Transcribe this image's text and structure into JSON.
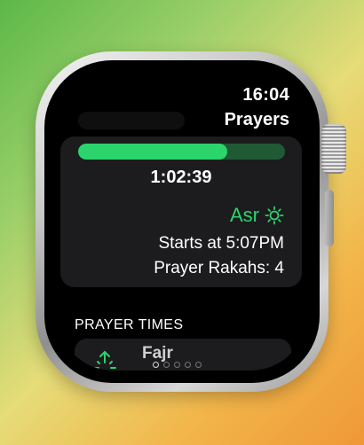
{
  "status": {
    "time": "16:04"
  },
  "app": {
    "title": "Prayers"
  },
  "current": {
    "progress": 0.72,
    "countdown": "1:02:39",
    "prayer_name": "Asr",
    "prayer_icon": "sun-icon",
    "starts_at": "Starts at 5:07PM",
    "rakahs": "Prayer Rakahs: 4"
  },
  "list": {
    "header": "PRAYER TIMES",
    "items": [
      {
        "name": "Fajr",
        "icon": "sunrise-icon"
      }
    ]
  },
  "page_indicator": {
    "count": 5,
    "active": 0
  },
  "colors": {
    "accent": "#2bd46c",
    "accent_track": "#1f5a35",
    "card": "#1c1c1e"
  }
}
